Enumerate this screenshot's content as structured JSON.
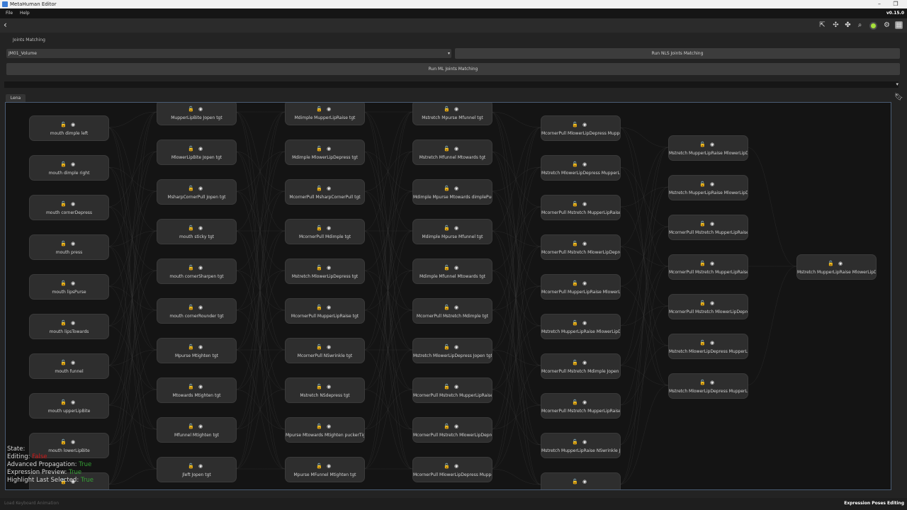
{
  "window": {
    "title": "MetaHuman Editor",
    "minimize": "–",
    "maximize": "❐",
    "close": "✕"
  },
  "menu": {
    "items": [
      "File",
      "Help"
    ],
    "version": "v0.15.0"
  },
  "toolbar": {
    "back": "‹",
    "icons": [
      "cursor-icon",
      "add-joint-icon",
      "remove-joint-icon",
      "zoom-icon",
      "status-indicator-icon",
      "settings-icon",
      "layout-icon"
    ]
  },
  "joints_matching": {
    "section_label": "Joints Matching",
    "dropdown_value": "JM01_Volume",
    "run_nls_label": "Run NLS Joints Matching",
    "run_ml_label": "Run ML Joints Matching"
  },
  "tabs": {
    "active": "Lena"
  },
  "graph": {
    "columns": [
      [
        "mouth dimple left",
        "mouth dimple right",
        "mouth cornerDepress",
        "mouth press",
        "mouth lipsPurse",
        "mouth lipsTowards",
        "mouth funnel",
        "mouth upperLipBite",
        "mouth lowerLipBite",
        ""
      ],
      [
        "MupperLipBite Jopen tgt",
        "MlowerLipBite Jopen tgt",
        "MsharpCornerPull Jopen tgt",
        "mouth sticky tgt",
        "mouth cornerSharpen tgt",
        "mouth cornerRounder tgt",
        "Mpurse Mtighten tgt",
        "Mtowards Mtighten tgt",
        "Mfunnel Mtighten tgt",
        "Jleft Jopen tgt"
      ],
      [
        "Mdimple MupperLipRaise tgt",
        "Mdimple MlowerLipDepress tgt",
        "McornerPull MsharpCornerPull tgt",
        "McornerPull Mdimple tgt",
        "Mstretch MlowerLipDepress tgt",
        "McornerPull MupperLipRaise tgt",
        "McornerPull NSwrinkle tgt",
        "Mstretch NSdepress tgt",
        "Mpurse Mtowards Mtighten  puckerTighten tgt",
        "Mpurse MFunnel Mtighten tgt"
      ],
      [
        "Mstretch Mpurse Mfunnel tgt",
        "Mstretch Mfunnel Mtowards tgt",
        "Mdimple Mpurse Mtowards  dimplePucker tgt",
        "Mdimple Mpurse Mfunnel tgt",
        "Mdimple Mfunnel Mtowards tgt",
        "McornerPull Mstretch Mdimple tgt",
        "Mstretch MlowerLipDepress Jopen tgt",
        "McornerPull Mstretch MupperLipRaise tgt",
        "McornerPull Mstretch MlowerLipDepress tgt",
        "McornerPull MlowerLipDepress MupperLipRaise tgt"
      ],
      [
        "McornerPull MlowerLipDepress MupperLipRaise Jopen tgt",
        "Mstretch MlowerLipDepress MupperLipRaise Jopen tgt",
        "McornerPull Mstretch MupperLipRaise Mdimple tgt",
        "McornerPull Mstretch MlowerLipDepress Mdimple tgt",
        "McornerPull MupperLipRaise MlowerLipDepress Mdimple tgt",
        "Mstretch MupperLipRaise MlowerLipDepress Mdimple tgt",
        "McornerPull Mstretch Mdimple Jopen tgt",
        "McornerPull Mstretch MupperLipRaise NSwrinkle tgt",
        "Mstretch MupperLipRaise NSwrinkle Jopen tgt",
        ""
      ],
      [
        "Mstretch MupperLipRaise MlowerLipDepre",
        "Mstretch MupperLipRaise MlowerLipDepres",
        "McornerPull Mstretch MupperLipRaise NSwrinkle Jo",
        "McornerPull Mstretch MupperLipRaise JopenExtre",
        "McornerPull Mstretch MlowerLipDepress JopenExtr",
        "Mstretch MlowerLipDepress MupperLipRaise Jopen",
        "Mstretch MlowerLipDepress MupperLipRaise JopenEx"
      ],
      [
        "Mstretch MupperLipRaise MlowerLipDepress Jo"
      ]
    ],
    "lock_icon": "🔓",
    "eye_icon": "◉"
  },
  "status": {
    "state_label": "State:",
    "editing_label": "Editing:",
    "editing_value": "False",
    "propagation_label": "Advanced Propagation:",
    "propagation_value": "True",
    "preview_label": "Expression Preview:",
    "preview_value": "True",
    "highlight_label": "Highlight Last Selected:",
    "highlight_value": "True"
  },
  "footer": {
    "left": "Load Keyboard Animation",
    "right": "Expression Poses Editing"
  },
  "colors": {
    "canvas_bg": "#141414",
    "node_bg": "#2e2e2e",
    "false": "#d01818",
    "true": "#35a035",
    "status_indicator": "#a6e03a"
  }
}
